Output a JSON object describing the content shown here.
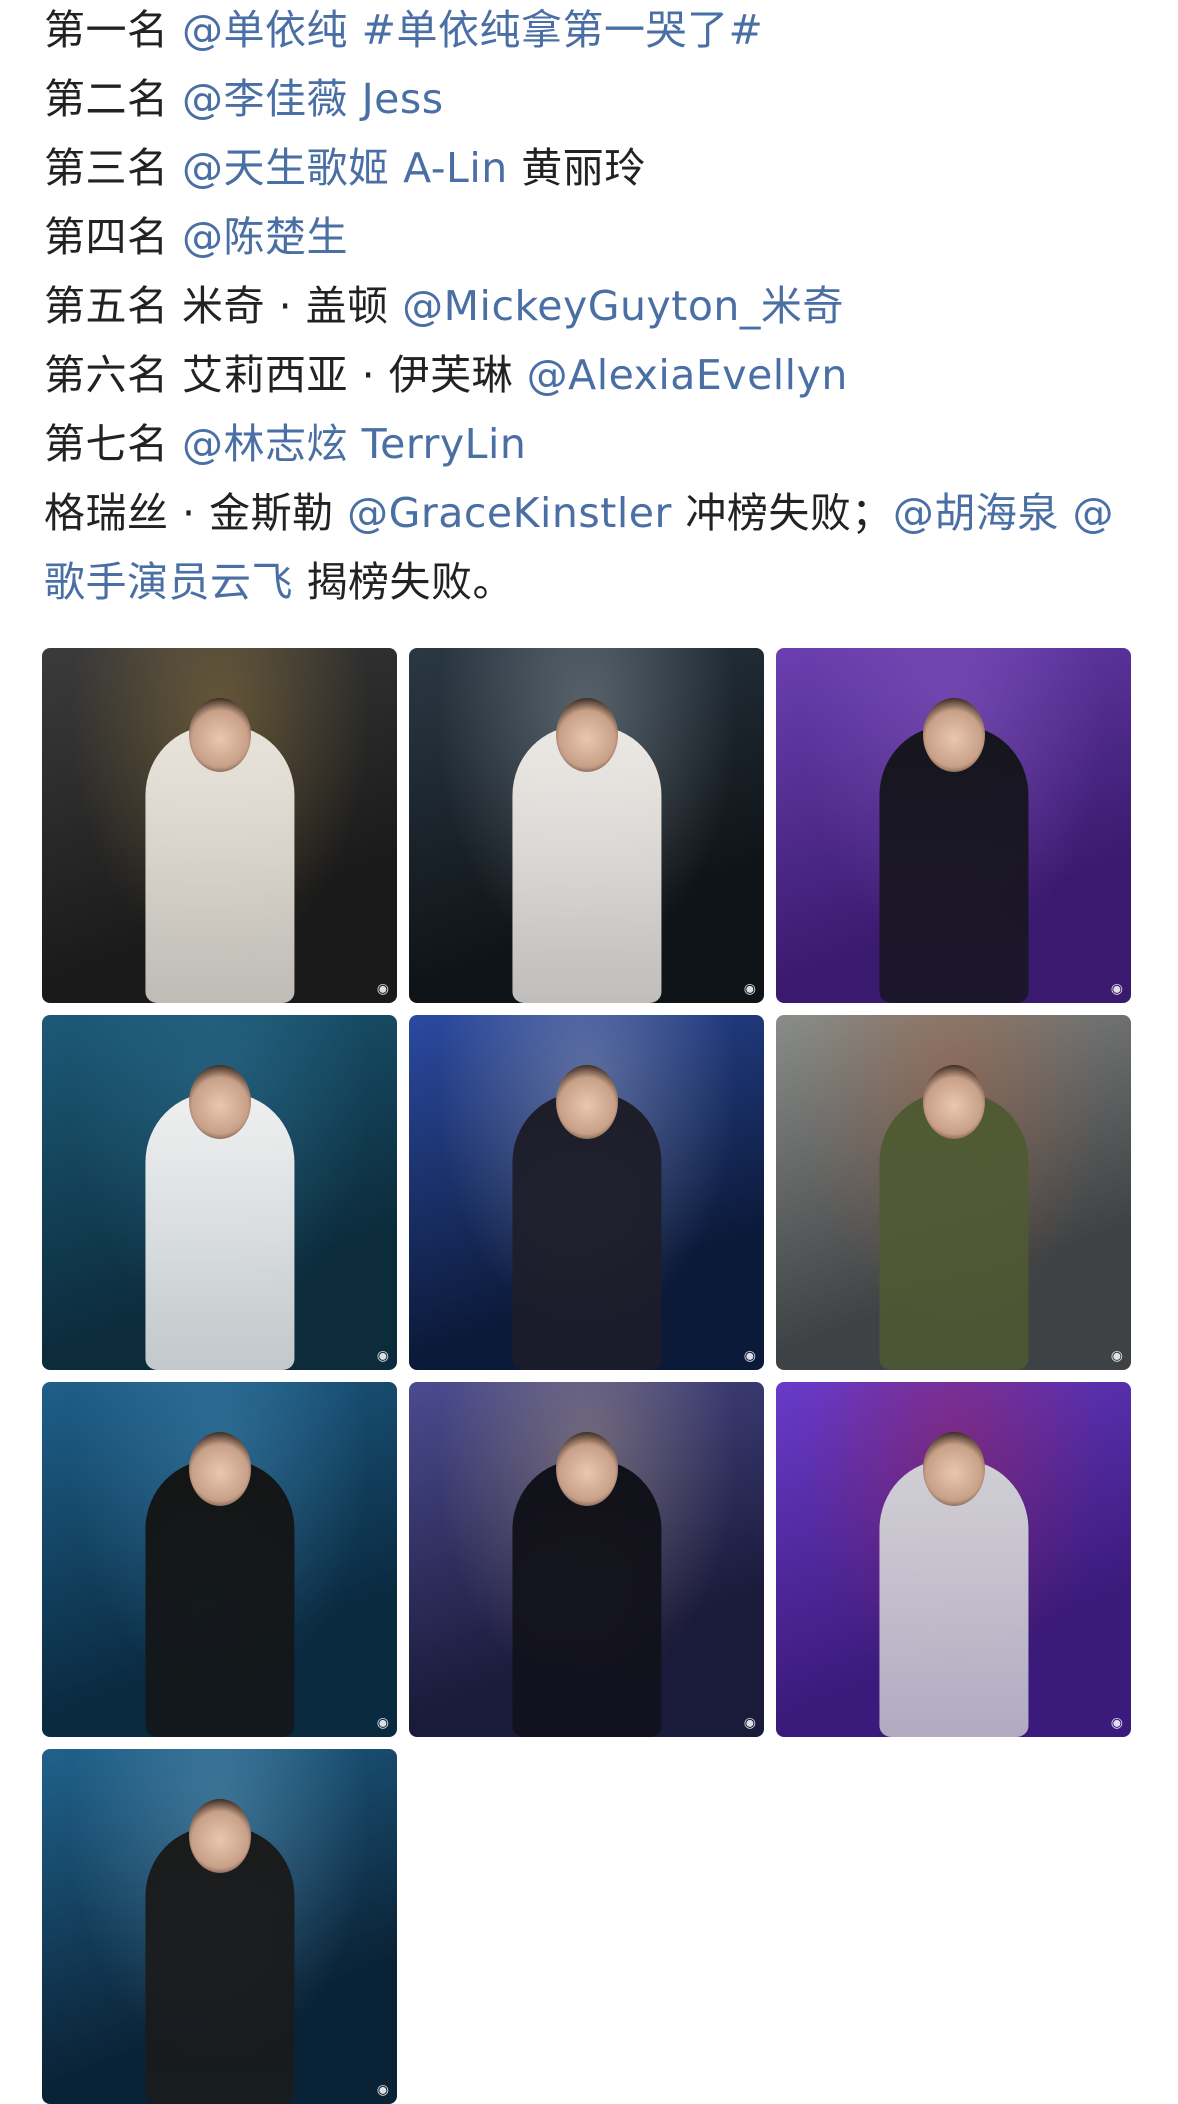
{
  "post": {
    "lines": [
      [
        {
          "t": "第一名 ",
          "k": "text"
        },
        {
          "t": "@单依纯",
          "k": "mention"
        },
        {
          "t": " ",
          "k": "text"
        },
        {
          "t": "#单依纯拿第一哭了#",
          "k": "topic"
        }
      ],
      [
        {
          "t": "第二名 ",
          "k": "text"
        },
        {
          "t": "@李佳薇 Jess",
          "k": "mention"
        }
      ],
      [
        {
          "t": "第三名 ",
          "k": "text"
        },
        {
          "t": "@天生歌姬 A-Lin",
          "k": "mention"
        },
        {
          "t": " 黄丽玲",
          "k": "text"
        }
      ],
      [
        {
          "t": "第四名 ",
          "k": "text"
        },
        {
          "t": "@陈楚生",
          "k": "mention"
        }
      ],
      [
        {
          "t": "第五名 米奇 · 盖顿 ",
          "k": "text"
        },
        {
          "t": "@MickeyGuyton_米奇",
          "k": "mention"
        }
      ],
      [
        {
          "t": "第六名 艾莉西亚 · 伊芙琳 ",
          "k": "text"
        },
        {
          "t": "@AlexiaEvellyn",
          "k": "mention"
        }
      ],
      [
        {
          "t": "第七名 ",
          "k": "text"
        },
        {
          "t": "@林志炫 TerryLin",
          "k": "mention"
        }
      ],
      [
        {
          "t": "格瑞丝 · 金斯勒 ",
          "k": "text"
        },
        {
          "t": "@GraceKinstler",
          "k": "mention"
        },
        {
          "t": " 冲榜失败；",
          "k": "text"
        },
        {
          "t": "@胡海泉",
          "k": "mention"
        },
        {
          "t": " ",
          "k": "text"
        },
        {
          "t": "@歌手演员云飞",
          "k": "mention"
        },
        {
          "t": " 揭榜失败。",
          "k": "text"
        }
      ]
    ]
  },
  "photos": [
    {
      "icon": "weibo-watermark-icon",
      "bg": [
        "#1a1a1a",
        "#3b3b3b"
      ],
      "dress": "#e8e4dc",
      "accent": "#d4a64a"
    },
    {
      "icon": "weibo-watermark-icon",
      "bg": [
        "#0f1418",
        "#2a3844"
      ],
      "dress": "#ece8e4",
      "accent": "#c9d4dc"
    },
    {
      "icon": "weibo-watermark-icon",
      "bg": [
        "#3a1a6e",
        "#6b3fb0"
      ],
      "dress": "#15151c",
      "accent": "#a070d8"
    },
    {
      "icon": "weibo-watermark-icon",
      "bg": [
        "#0c2c3c",
        "#1c5a78"
      ],
      "dress": "#efefef",
      "accent": "#3d8ab0"
    },
    {
      "icon": "weibo-watermark-icon",
      "bg": [
        "#0c1a3a",
        "#2b4aa0"
      ],
      "dress": "#1d1d28",
      "accent": "#d8d8e8"
    },
    {
      "icon": "weibo-watermark-icon",
      "bg": [
        "#3e4244",
        "#8a8c88"
      ],
      "dress": "#4f5a32",
      "accent": "#c05a2a"
    },
    {
      "icon": "weibo-watermark-icon",
      "bg": [
        "#0a2a40",
        "#1e5f8a"
      ],
      "dress": "#141414",
      "accent": "#5aa8d8"
    },
    {
      "icon": "weibo-watermark-icon",
      "bg": [
        "#1a1a3a",
        "#4b4b90"
      ],
      "dress": "#101018",
      "accent": "#e0c890"
    },
    {
      "icon": "weibo-watermark-icon",
      "bg": [
        "#3a1a7a",
        "#6a3ac8"
      ],
      "dress": "#cfcfd4",
      "accent": "#c02030"
    },
    {
      "icon": "weibo-watermark-icon",
      "bg": [
        "#0a2236",
        "#20628c"
      ],
      "dress": "#1a1a1a",
      "accent": "#8ac8e8"
    }
  ]
}
